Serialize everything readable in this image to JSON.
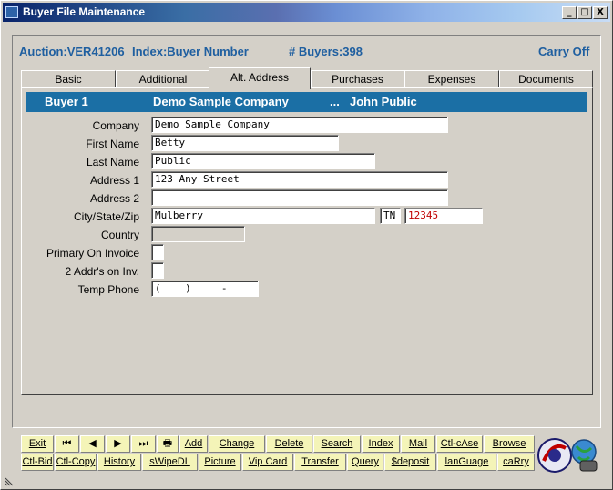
{
  "window": {
    "title": "Buyer File Maintenance",
    "controls": {
      "minimize": "_",
      "restore": "□",
      "close": "X"
    }
  },
  "header": {
    "auction": "Auction:VER41206",
    "index": "Index:Buyer Number",
    "buyers": "# Buyers:398",
    "carry": "Carry Off"
  },
  "tabs": [
    "Basic",
    "Additional",
    "Alt. Address",
    "Purchases",
    "Expenses",
    "Documents"
  ],
  "active_tab": "Alt. Address",
  "buyer_bar": {
    "buyer": "Buyer 1",
    "company": "Demo Sample Company",
    "sep": "...",
    "name": "John Public"
  },
  "form": {
    "company": {
      "label": "Company",
      "value": "Demo Sample Company"
    },
    "first_name": {
      "label": "First Name",
      "value": "Betty"
    },
    "last_name": {
      "label": "Last Name",
      "value": "Public"
    },
    "address1": {
      "label": "Address 1",
      "value": "123 Any Street"
    },
    "address2": {
      "label": "Address 2",
      "value": ""
    },
    "city_state_zip": {
      "label": "City/State/Zip",
      "city": "Mulberry",
      "state": "TN",
      "zip": "12345"
    },
    "country": {
      "label": "Country",
      "value": ""
    },
    "primary_invoice": {
      "label": "Primary On Invoice",
      "value": ""
    },
    "two_addr": {
      "label": "2 Addr's on Inv.",
      "value": ""
    },
    "temp_phone": {
      "label": "Temp Phone",
      "value": "(    )     -"
    }
  },
  "toolbar": {
    "row1": [
      "Exit",
      "⏮",
      "◀",
      "▶",
      "⏭",
      "🖶",
      "Add",
      "Change",
      "Delete",
      "Search",
      "Index",
      "Mail",
      "Ctl-cAse",
      "Browse"
    ],
    "row2": [
      "Ctl-Bid",
      "Ctl-Copy",
      "History",
      "sWipeDL",
      "Picture",
      "Vip Card",
      "Transfer",
      "Query",
      "$deposit",
      "lanGuage",
      "caRry"
    ]
  },
  "colors": {
    "accent": "#1f5fa0",
    "buyer_bar": "#1b6fa5",
    "toolbar": "#f4f4b8",
    "zip_text": "#c00000"
  }
}
